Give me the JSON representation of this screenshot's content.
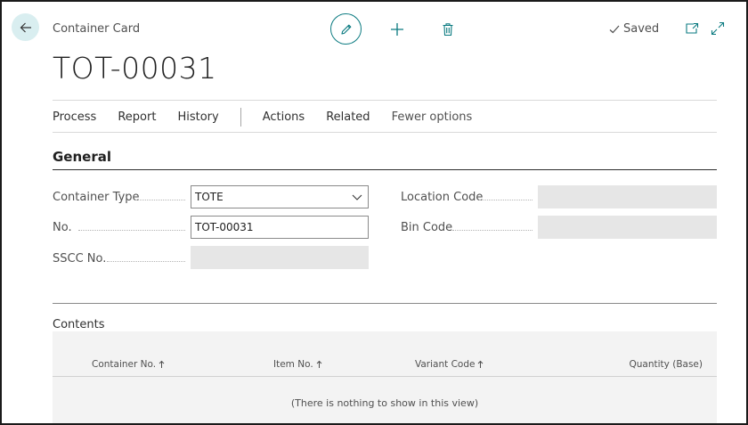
{
  "header": {
    "caption": "Container Card",
    "title": "TOT-00031",
    "status": "Saved"
  },
  "actions": {
    "items": [
      "Process",
      "Report",
      "History"
    ],
    "secondary": [
      "Actions",
      "Related"
    ],
    "fewer_options": "Fewer options"
  },
  "general": {
    "title": "General",
    "container_type": {
      "label": "Container Type",
      "value": "TOTE"
    },
    "no": {
      "label": "No.",
      "value": "TOT-00031"
    },
    "sscc_no": {
      "label": "SSCC No.",
      "value": ""
    },
    "location_code": {
      "label": "Location Code",
      "value": ""
    },
    "bin_code": {
      "label": "Bin Code",
      "value": ""
    }
  },
  "contents": {
    "title": "Contents",
    "columns": [
      "Container No.",
      "Item No.",
      "Variant Code",
      "Quantity (Base)"
    ],
    "empty_text": "(There is nothing to show in this view)"
  },
  "colors": {
    "accent": "#0a7a80",
    "back_bg": "#d9eef0"
  }
}
